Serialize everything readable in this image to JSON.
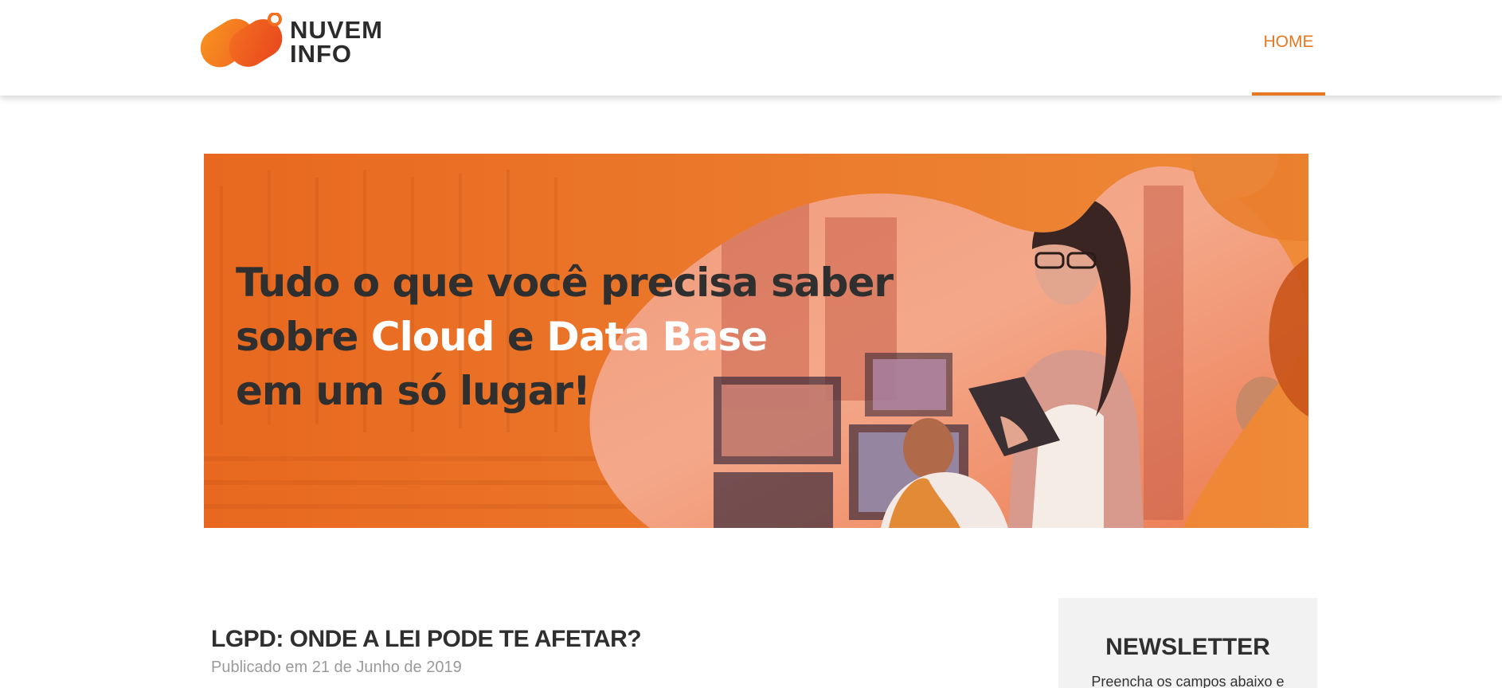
{
  "header": {
    "logo": {
      "line1": "NUVEM",
      "line2": "INFO"
    },
    "nav": [
      {
        "label": "HOME",
        "active": true
      }
    ]
  },
  "banner": {
    "line1": "Tudo o que você precisa saber",
    "line2_prefix": "sobre ",
    "line2_hl1": "Cloud",
    "line2_mid": " e ",
    "line2_hl2": "Data Base",
    "line3": "em um só lugar!"
  },
  "post": {
    "title": "LGPD: ONDE A LEI PODE TE AFETAR?",
    "date": "Publicado em 21 de Junho de 2019"
  },
  "sidebar": {
    "title": "NEWSLETTER",
    "text": "Preencha os campos abaixo e"
  },
  "colors": {
    "accent": "#e87722",
    "banner_orange": "#e8762a",
    "text_dark": "#2f2f2f",
    "muted": "#9a9a9a",
    "sidebar_bg": "#f2f2f2"
  }
}
